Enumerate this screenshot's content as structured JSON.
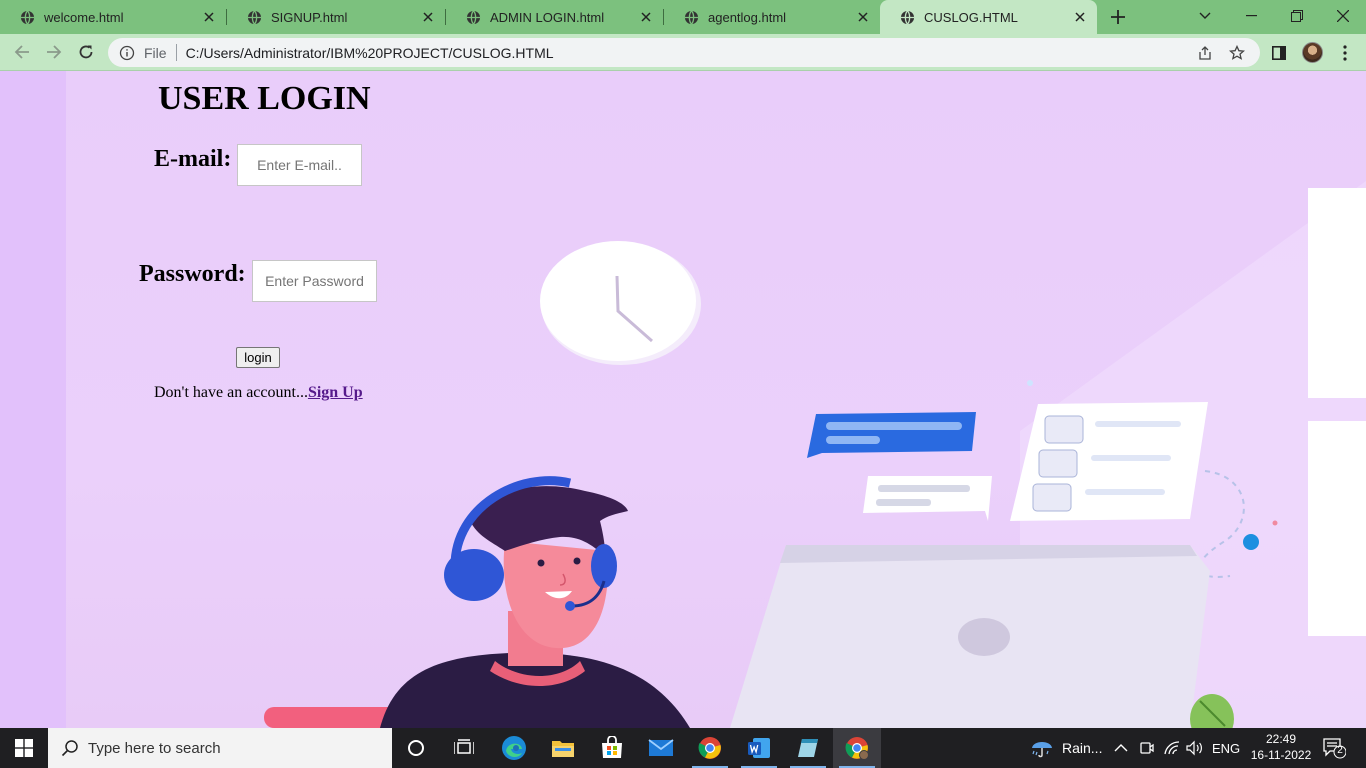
{
  "browser": {
    "tabs": [
      {
        "title": "welcome.html",
        "active": false
      },
      {
        "title": "SIGNUP.html",
        "active": false
      },
      {
        "title": "ADMIN LOGIN.html",
        "active": false
      },
      {
        "title": "agentlog.html",
        "active": false
      },
      {
        "title": "CUSLOG.HTML",
        "active": true
      }
    ],
    "address_bar": {
      "security_label": "File",
      "url": "C:/Users/Administrator/IBM%20PROJECT/CUSLOG.HTML"
    }
  },
  "page": {
    "title": "USER LOGIN",
    "email_label": "E-mail:",
    "email_placeholder": "Enter E-mail..",
    "email_value": "",
    "password_label": "Password:",
    "password_placeholder": "Enter Password",
    "password_value": "",
    "login_button": "login",
    "signup_prompt": "Don't have an account...",
    "signup_link": "Sign Up"
  },
  "taskbar": {
    "search_placeholder": "Type here to search",
    "weather": "Rain...",
    "language": "ENG",
    "time": "22:49",
    "date": "16-11-2022",
    "notification_count": "2"
  },
  "colors": {
    "tab_strip": "#7cc17e",
    "active_tab": "#c3e7c4",
    "page_background": "#e9cdfa",
    "taskbar": "#1f1f22",
    "link": "#551a8b"
  }
}
